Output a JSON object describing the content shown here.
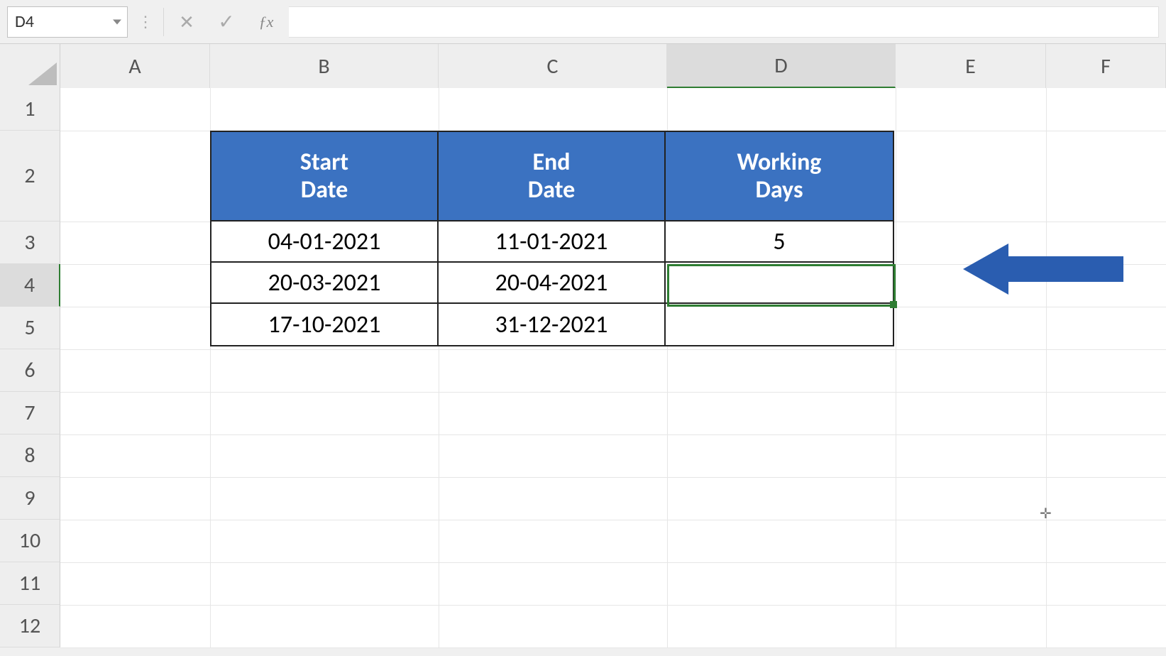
{
  "nameBox": {
    "value": "D4"
  },
  "formulaBar": {
    "value": ""
  },
  "columns": [
    "A",
    "B",
    "C",
    "D",
    "E",
    "F"
  ],
  "selectedColumn": "D",
  "rows": [
    "1",
    "2",
    "3",
    "4",
    "5",
    "6",
    "7",
    "8",
    "9",
    "10",
    "11",
    "12"
  ],
  "selectedRow": "4",
  "table": {
    "headers": {
      "startDate": "Start\nDate",
      "endDate": "End\nDate",
      "workingDays": "Working\nDays"
    },
    "data": [
      {
        "start": "04-01-2021",
        "end": "11-01-2021",
        "working": "5"
      },
      {
        "start": "20-03-2021",
        "end": "20-04-2021",
        "working": ""
      },
      {
        "start": "17-10-2021",
        "end": "31-12-2021",
        "working": ""
      }
    ]
  },
  "annotation": {
    "arrowColor": "#2a5db0"
  },
  "cursorGlyph": "✛"
}
